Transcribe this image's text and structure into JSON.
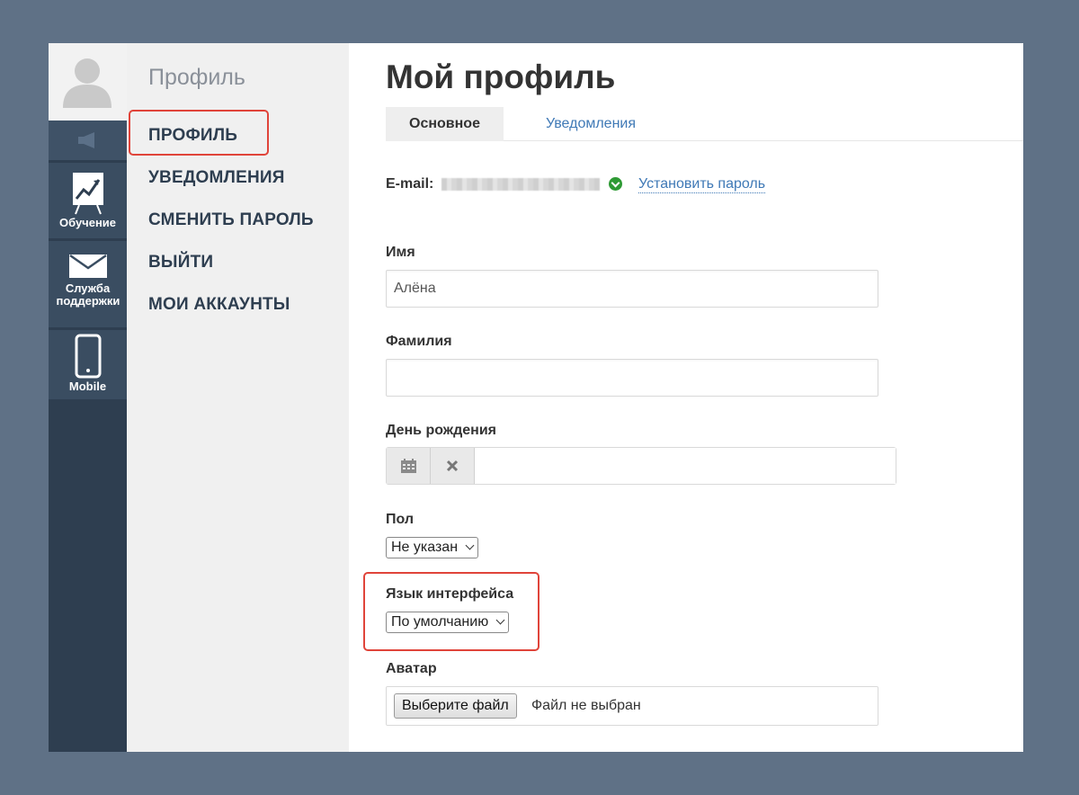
{
  "rail": {
    "items": [
      {
        "label": "Обучение",
        "icon": "chart-board-icon"
      },
      {
        "label": "Служба поддержки",
        "icon": "envelope-icon"
      },
      {
        "label": "Mobile",
        "icon": "smartphone-icon"
      }
    ]
  },
  "subnav": {
    "title": "Профиль",
    "items": [
      {
        "label": "ПРОФИЛЬ"
      },
      {
        "label": "УВЕДОМЛЕНИЯ"
      },
      {
        "label": "СМЕНИТЬ ПАРОЛЬ"
      },
      {
        "label": "ВЫЙТИ"
      },
      {
        "label": "МОИ АККАУНТЫ"
      }
    ]
  },
  "main": {
    "title": "Мой профиль",
    "tabs": [
      {
        "label": "Основное"
      },
      {
        "label": "Уведомления"
      }
    ],
    "email_label": "E-mail:",
    "set_password": "Установить пароль",
    "fields": {
      "first_name_label": "Имя",
      "first_name_value": "Алёна",
      "last_name_label": "Фамилия",
      "last_name_value": "",
      "birthday_label": "День рождения",
      "birthday_value": "",
      "gender_label": "Пол",
      "gender_value": "Не указан",
      "language_label": "Язык интерфейса",
      "language_value": "По умолчанию",
      "avatar_label": "Аватар",
      "file_button": "Выберите файл",
      "file_status": "Файл не выбран"
    }
  },
  "colors": {
    "background": "#5f7186",
    "rail": "#2e3e50",
    "highlight": "#e0443a",
    "link": "#3f79b6",
    "verified": "#2e9a34"
  }
}
